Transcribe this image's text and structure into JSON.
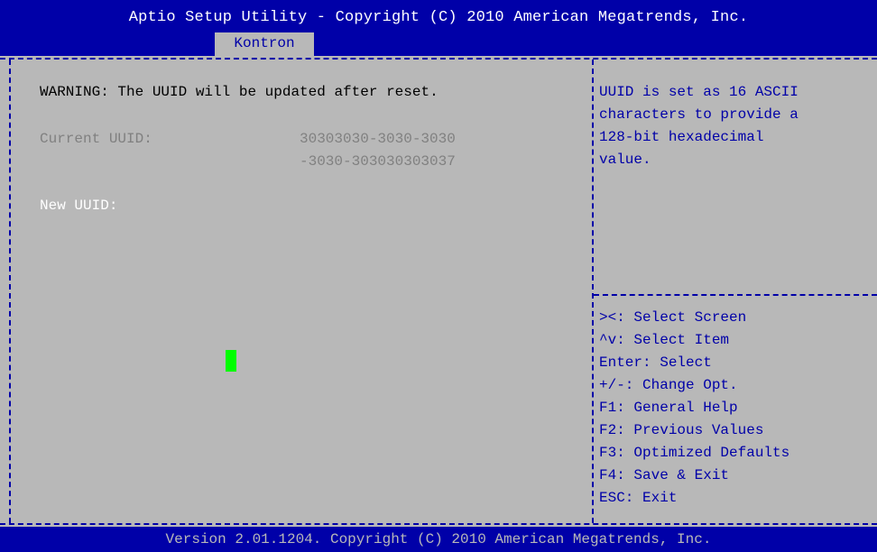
{
  "header": {
    "title": "Aptio Setup Utility - Copyright (C) 2010 American Megatrends, Inc.",
    "tab": "Kontron"
  },
  "main": {
    "warning": "WARNING: The UUID will be updated after reset.",
    "current_uuid_label": "Current UUID:",
    "current_uuid_line1": "30303030-3030-3030",
    "current_uuid_line2": "-3030-303030303037",
    "new_uuid_label": "New UUID:"
  },
  "help": {
    "description": [
      "UUID is set as 16 ASCII",
      "characters to provide a",
      "128-bit hexadecimal",
      "value."
    ],
    "keys": [
      "><: Select Screen",
      "^v: Select Item",
      "Enter: Select",
      "+/-: Change Opt.",
      "F1: General Help",
      "F2: Previous Values",
      "F3: Optimized Defaults",
      "F4: Save & Exit",
      "ESC: Exit"
    ]
  },
  "footer": {
    "version": "Version 2.01.1204. Copyright (C) 2010 American Megatrends, Inc."
  },
  "colors": {
    "bios_blue": "#0000a8",
    "panel_gray": "#b8b8b8",
    "cursor_green": "#00ff00"
  }
}
